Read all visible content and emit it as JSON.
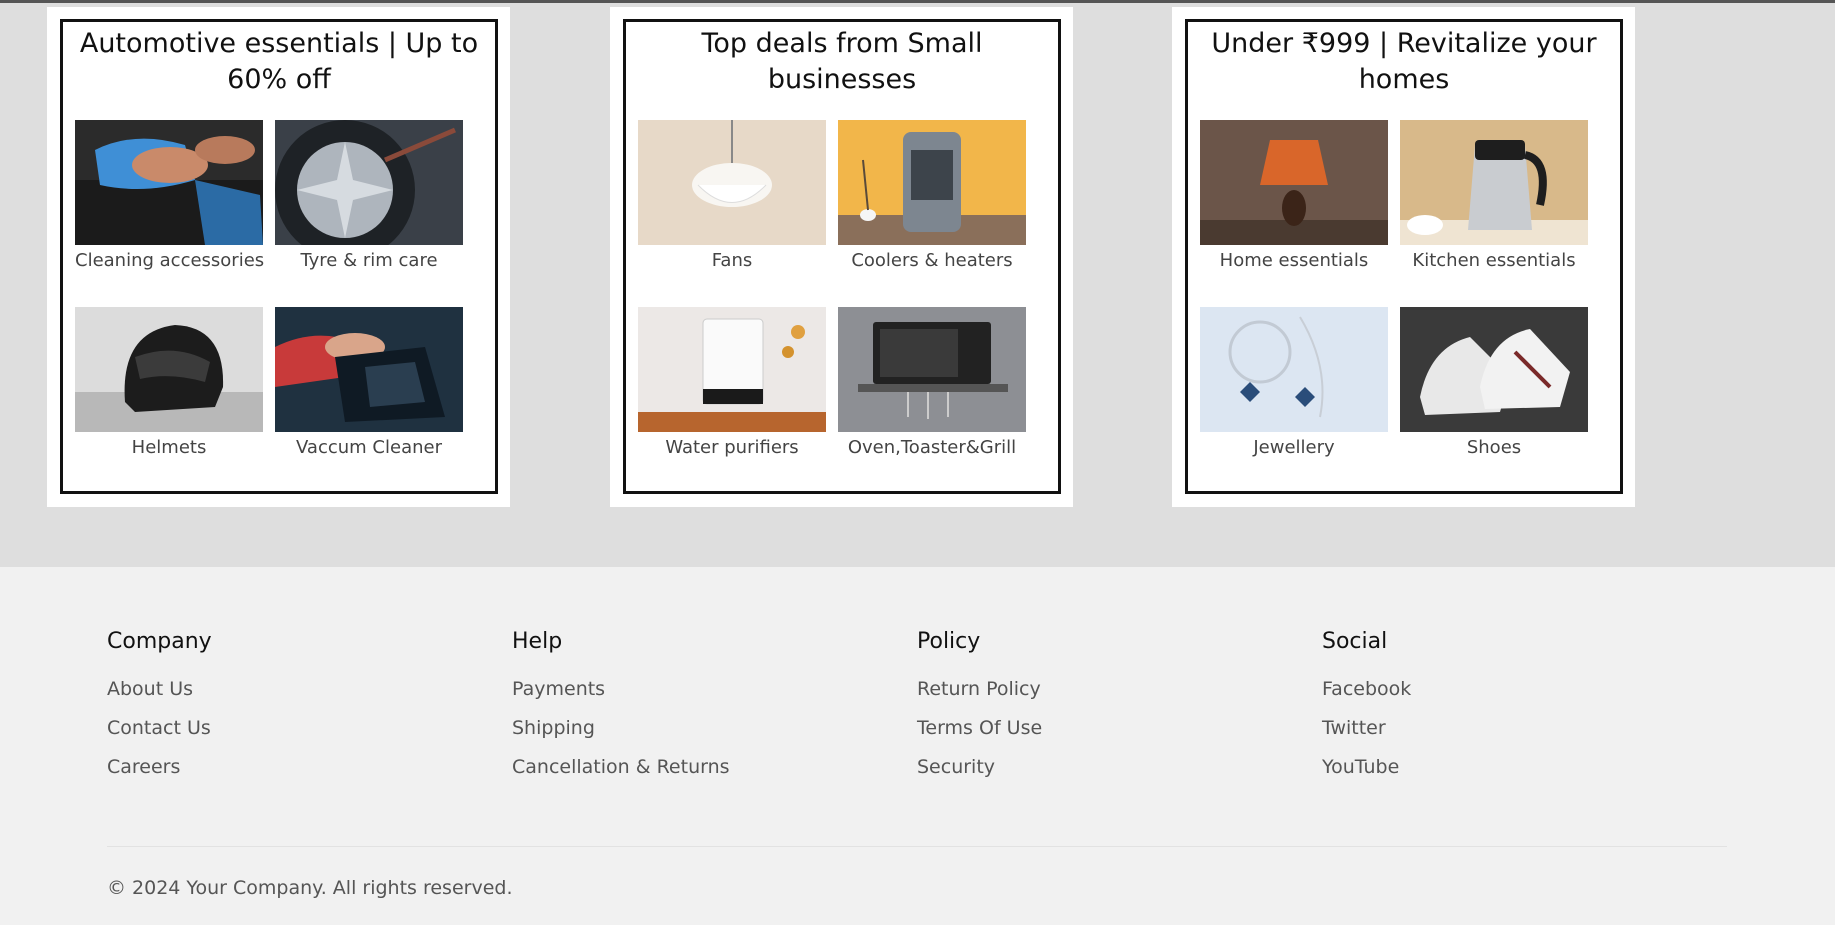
{
  "cards": [
    {
      "title": "Automotive essentials | Up to 60% off",
      "tiles": [
        {
          "label": "Cleaning accessories",
          "icon": "car-cleaning-image"
        },
        {
          "label": "Tyre & rim care",
          "icon": "tyre-rim-image"
        },
        {
          "label": "Helmets",
          "icon": "helmet-image"
        },
        {
          "label": "Vaccum Cleaner",
          "icon": "vacuum-image"
        }
      ]
    },
    {
      "title": "Top deals from Small businesses",
      "tiles": [
        {
          "label": "Fans",
          "icon": "ceiling-fan-image"
        },
        {
          "label": "Coolers & heaters",
          "icon": "air-cooler-image"
        },
        {
          "label": "Water purifiers",
          "icon": "water-purifier-image"
        },
        {
          "label": "Oven,Toaster&Grill",
          "icon": "microwave-image"
        }
      ]
    },
    {
      "title": "Under ₹999 | Revitalize your homes",
      "tiles": [
        {
          "label": "Home essentials",
          "icon": "lamp-image"
        },
        {
          "label": "Kitchen essentials",
          "icon": "kettle-image"
        },
        {
          "label": "Jewellery",
          "icon": "jewellery-image"
        },
        {
          "label": "Shoes",
          "icon": "shoes-image"
        }
      ]
    }
  ],
  "footer": {
    "columns": [
      {
        "heading": "Company",
        "links": [
          "About Us",
          "Contact Us",
          "Careers"
        ]
      },
      {
        "heading": "Help",
        "links": [
          "Payments",
          "Shipping",
          "Cancellation & Returns"
        ]
      },
      {
        "heading": "Policy",
        "links": [
          "Return Policy",
          "Terms Of Use",
          "Security"
        ]
      },
      {
        "heading": "Social",
        "links": [
          "Facebook",
          "Twitter",
          "YouTube"
        ]
      }
    ],
    "copyright": "© 2024 Your Company. All rights reserved."
  }
}
